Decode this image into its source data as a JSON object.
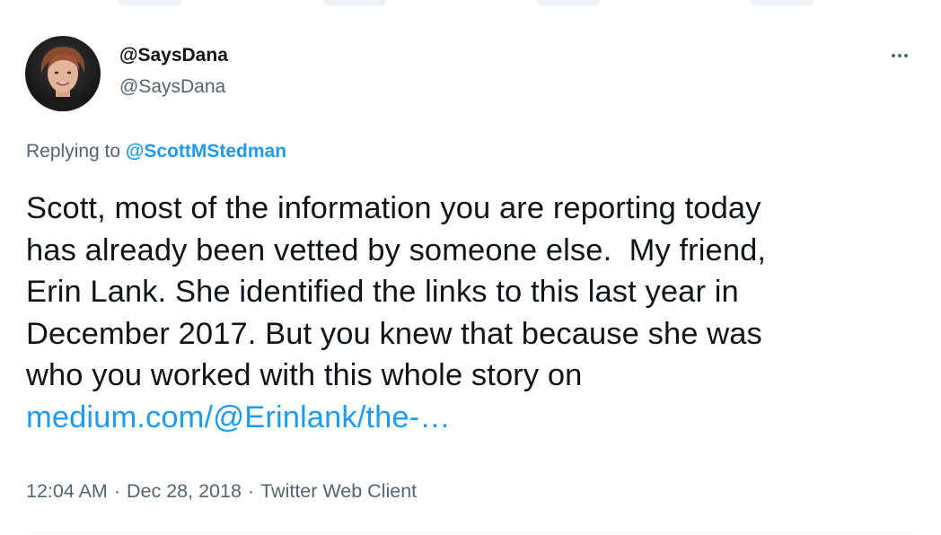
{
  "author": {
    "display_name": "@SaysDana",
    "handle": "@SaysDana",
    "avatar_icon": "profile-photo-icon",
    "more_icon": "more-options-icon"
  },
  "reply": {
    "prefix": "Replying to ",
    "target": "@ScottMStedman"
  },
  "tweet": {
    "lines": [
      "Scott, most of the information you are reporting today",
      "has already been vetted by someone else.  My friend,",
      "Erin Lank. She identified the links to this last year in",
      "December 2017. But you knew that because she was",
      "who you worked with this whole story on"
    ],
    "link": "medium.com/@Erinlank/the-…"
  },
  "meta": {
    "time": "12:04 AM",
    "separator": "·",
    "date": "Dec 28, 2018",
    "source": "Twitter Web Client"
  },
  "colors": {
    "text": "#0f1419",
    "secondary": "#536471",
    "link": "#1d9bf0",
    "divider": "#eff3f4"
  }
}
